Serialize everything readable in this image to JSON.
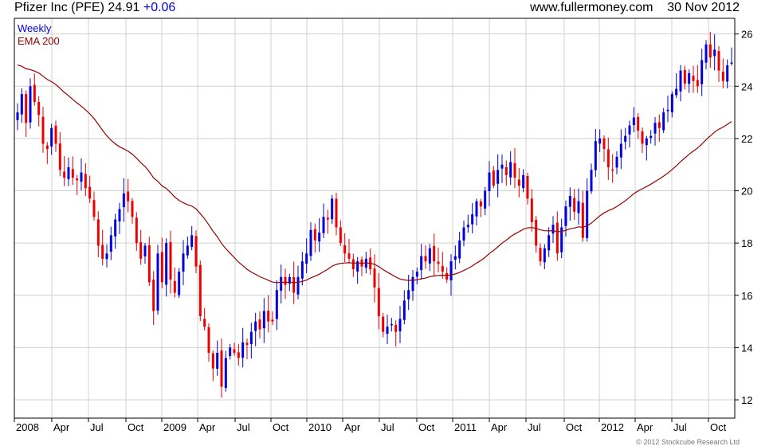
{
  "header": {
    "symbol_price": "Pfizer Inc (PFE) 24.91",
    "change": "+0.06",
    "site": "www.fullermoney.com",
    "date": "30 Nov 2012"
  },
  "footer": {
    "copyright": "© 2012 Stockcube Research Ltd"
  },
  "colors": {
    "up": "#0000dd",
    "down": "#ee0000",
    "ema": "#990000",
    "grid": "#d0d0d0"
  },
  "chart_data": {
    "type": "candlestick",
    "grid": true,
    "legend_position": "top-left",
    "series": [
      {
        "name": "Weekly",
        "color": "#0000dd",
        "kind": "weekly_candles",
        "closes": [
          23.0,
          23.7,
          22.6,
          24.0,
          23.4,
          22.9,
          21.8,
          21.6,
          22.4,
          21.8,
          20.8,
          20.5,
          20.9,
          20.5,
          20.4,
          20.7,
          20.1,
          19.7,
          19.0,
          17.9,
          17.4,
          17.6,
          18.3,
          18.9,
          19.3,
          19.9,
          19.6,
          19.0,
          18.0,
          17.4,
          17.9,
          16.5,
          15.4,
          17.6,
          16.5,
          18.0,
          16.6,
          16.1,
          16.9,
          17.6,
          17.9,
          18.3,
          17.1,
          15.2,
          14.8,
          13.8,
          13.2,
          13.8,
          12.5,
          13.6,
          14.0,
          13.8,
          13.6,
          14.2,
          14.1,
          14.6,
          15.0,
          14.7,
          15.4,
          15.0,
          15.0,
          16.2,
          16.7,
          16.4,
          16.7,
          16.1,
          16.7,
          17.3,
          17.6,
          18.5,
          18.1,
          18.4,
          19.0,
          18.9,
          19.7,
          18.6,
          18.0,
          17.6,
          17.4,
          17.0,
          17.3,
          17.1,
          17.4,
          17.0,
          16.3,
          15.2,
          14.6,
          14.8,
          14.9,
          14.6,
          15.1,
          15.8,
          16.2,
          16.7,
          16.9,
          17.5,
          17.3,
          17.8,
          17.3,
          17.2,
          16.9,
          16.6,
          17.3,
          17.5,
          18.1,
          18.6,
          18.7,
          19.1,
          19.6,
          19.4,
          20.0,
          20.7,
          20.2,
          20.8,
          21.0,
          20.6,
          21.1,
          20.5,
          20.2,
          20.6,
          19.7,
          18.8,
          17.9,
          17.3,
          17.8,
          18.3,
          18.7,
          17.6,
          18.6,
          19.4,
          19.8,
          19.2,
          19.6,
          18.2,
          20.0,
          20.8,
          21.9,
          22.0,
          21.6,
          20.9,
          20.8,
          21.3,
          21.8,
          22.1,
          22.5,
          22.8,
          22.3,
          21.8,
          22.0,
          22.1,
          22.6,
          22.4,
          23.0,
          23.1,
          23.7,
          23.9,
          24.6,
          24.1,
          24.5,
          24.2,
          24.0,
          25.0,
          25.6,
          25.1,
          25.4,
          24.6,
          24.2,
          24.8,
          24.91
        ]
      },
      {
        "name": "EMA 200",
        "color": "#990000",
        "kind": "line"
      }
    ],
    "x_ticks": [
      "2008",
      "Apr",
      "Jul",
      "Oct",
      "2009",
      "Apr",
      "Jul",
      "Oct",
      "2010",
      "Apr",
      "Jul",
      "Oct",
      "2011",
      "Apr",
      "Jul",
      "Oct",
      "2012",
      "Apr",
      "Jul",
      "Oct"
    ],
    "y_ticks": [
      "12",
      "14",
      "16",
      "18",
      "20",
      "22",
      "24",
      "26"
    ],
    "ylim": [
      11.3,
      26.6
    ]
  }
}
